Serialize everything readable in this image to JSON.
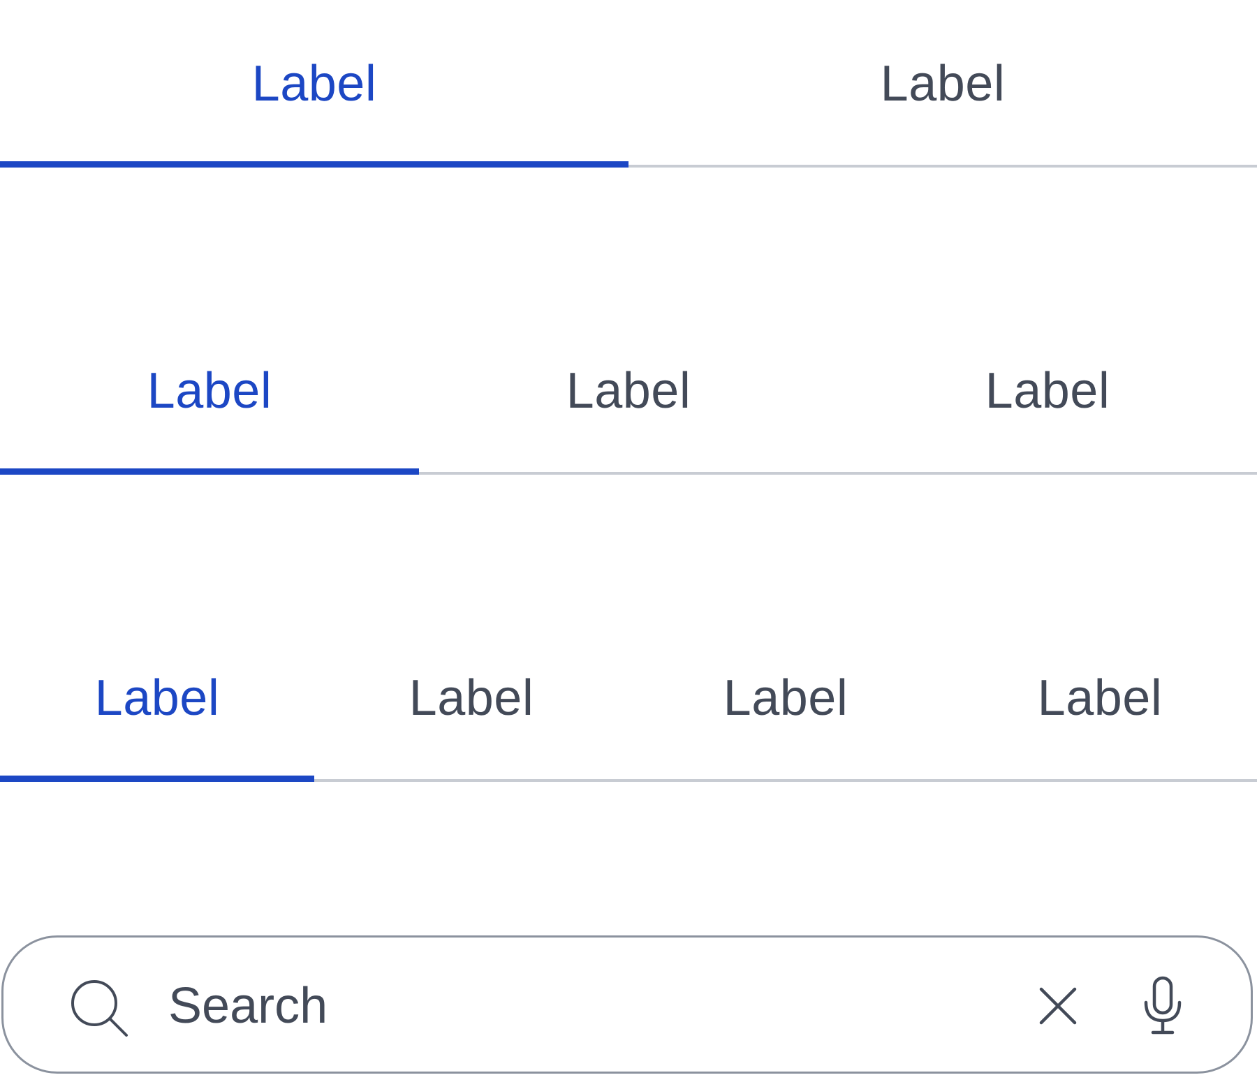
{
  "tab_bars": [
    {
      "tabs": [
        {
          "label": "Label",
          "active": true
        },
        {
          "label": "Label",
          "active": false
        }
      ]
    },
    {
      "tabs": [
        {
          "label": "Label",
          "active": true
        },
        {
          "label": "Label",
          "active": false
        },
        {
          "label": "Label",
          "active": false
        }
      ]
    },
    {
      "tabs": [
        {
          "label": "Label",
          "active": true
        },
        {
          "label": "Label",
          "active": false
        },
        {
          "label": "Label",
          "active": false
        },
        {
          "label": "Label",
          "active": false
        }
      ]
    }
  ],
  "search": {
    "placeholder": "Search",
    "value": "",
    "leading_icon": "search-icon",
    "trailing_icons": [
      "close-icon",
      "microphone-icon"
    ]
  },
  "colors": {
    "accent": "#1c47c4",
    "text": "#434a58",
    "divider": "#c8ccd3",
    "outline": "#8b929e"
  }
}
